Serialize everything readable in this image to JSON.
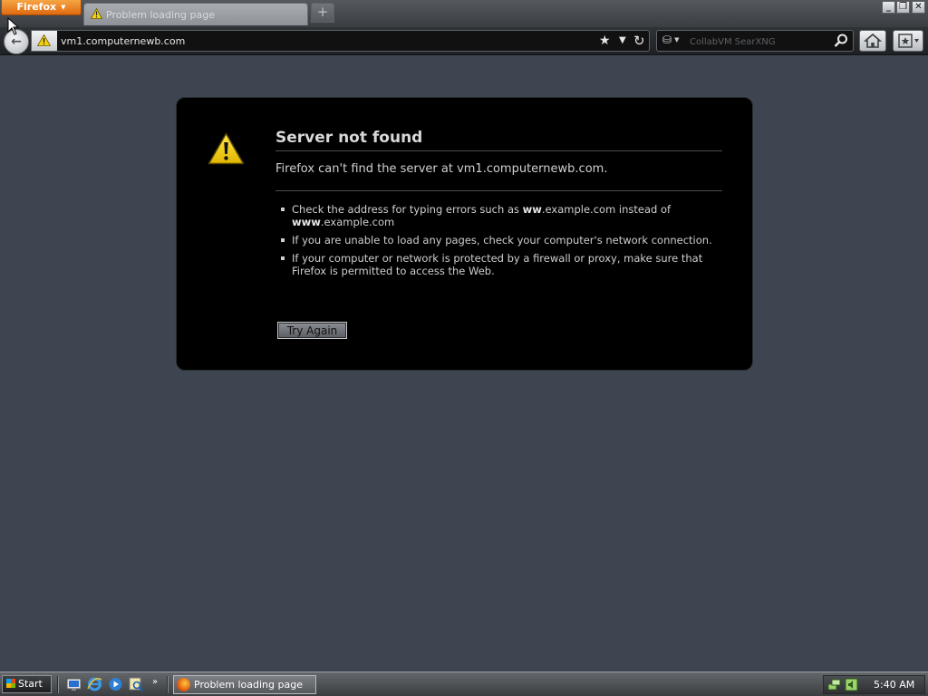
{
  "browser": {
    "menu_label": "Firefox",
    "tab": {
      "title": "Problem loading page"
    },
    "new_tab_label": "+",
    "window_controls": {
      "minimize": "_",
      "restore": "❐",
      "close": "✕"
    }
  },
  "navigation": {
    "back_icon": "back-arrow-icon",
    "url": "vm1.computernewb.com",
    "bookmark_star": "★",
    "dropdown": "▼",
    "reload": "↻",
    "search": {
      "engine_icon": "search-engine-icon",
      "placeholder": "CollabVM SearXNG"
    },
    "home_icon": "home-icon",
    "bookmarks_icon": "bookmarks-menu-icon"
  },
  "error_page": {
    "icon": "warning-triangle-icon",
    "title": "Server not found",
    "description": "Firefox can't find the server at vm1.computernewb.com.",
    "suggestions": {
      "s1": {
        "pre": "Check the address for typing errors such as ",
        "b1": "ww",
        "m1": ".example.com instead of ",
        "b2": "www",
        "m2": ".example.com"
      },
      "s2": "If you are unable to load any pages, check your computer's network connection.",
      "s3": "If your computer or network is protected by a firewall or proxy, make sure that Firefox is permitted to access the Web."
    },
    "button_label": "Try Again"
  },
  "taskbar": {
    "start_label": "Start",
    "quicklaunch": [
      "show-desktop-icon",
      "internet-explorer-icon",
      "windows-media-icon",
      "search-icon"
    ],
    "more": "»",
    "task": {
      "label": "Problem loading page",
      "icon": "firefox-icon"
    },
    "tray_icons": [
      "network-icon",
      "volume-icon"
    ],
    "clock": "5:40 AM"
  },
  "colors": {
    "page_background": "#3d4650",
    "error_box": "#000000",
    "firefox_button": "#e87b1e",
    "text": "#d0d0d0"
  }
}
